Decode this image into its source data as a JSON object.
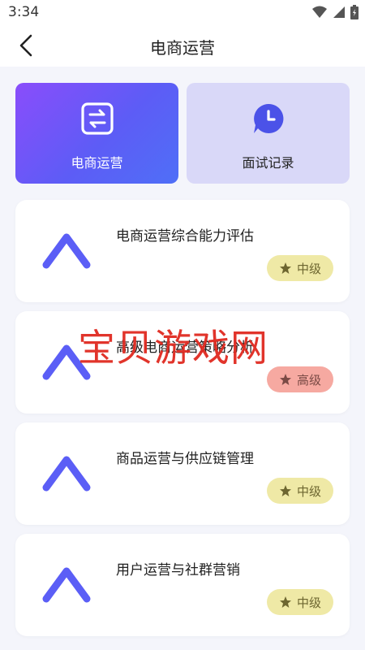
{
  "status_bar": {
    "time": "3:34"
  },
  "header": {
    "title": "电商运营",
    "back_icon": "chevron-left-icon"
  },
  "tabs": [
    {
      "label": "电商运营",
      "icon": "swap-arrows-icon",
      "active": true
    },
    {
      "label": "面试记录",
      "icon": "clock-chat-icon",
      "active": false
    }
  ],
  "cards": [
    {
      "title": "电商运营综合能力评估",
      "level": "中级",
      "icon": "chevron-up-icon"
    },
    {
      "title": "高级电商运营策略分析",
      "level": "高级",
      "icon": "chevron-up-icon"
    },
    {
      "title": "商品运营与供应链管理",
      "level": "中级",
      "icon": "chevron-up-icon"
    },
    {
      "title": "用户运营与社群营销",
      "level": "中级",
      "icon": "chevron-up-icon"
    }
  ],
  "watermark": "宝贝游戏网",
  "colors": {
    "accent": "#5b5ef6",
    "badge_mid": "#efe9a6",
    "badge_high": "#f6a9a1"
  }
}
